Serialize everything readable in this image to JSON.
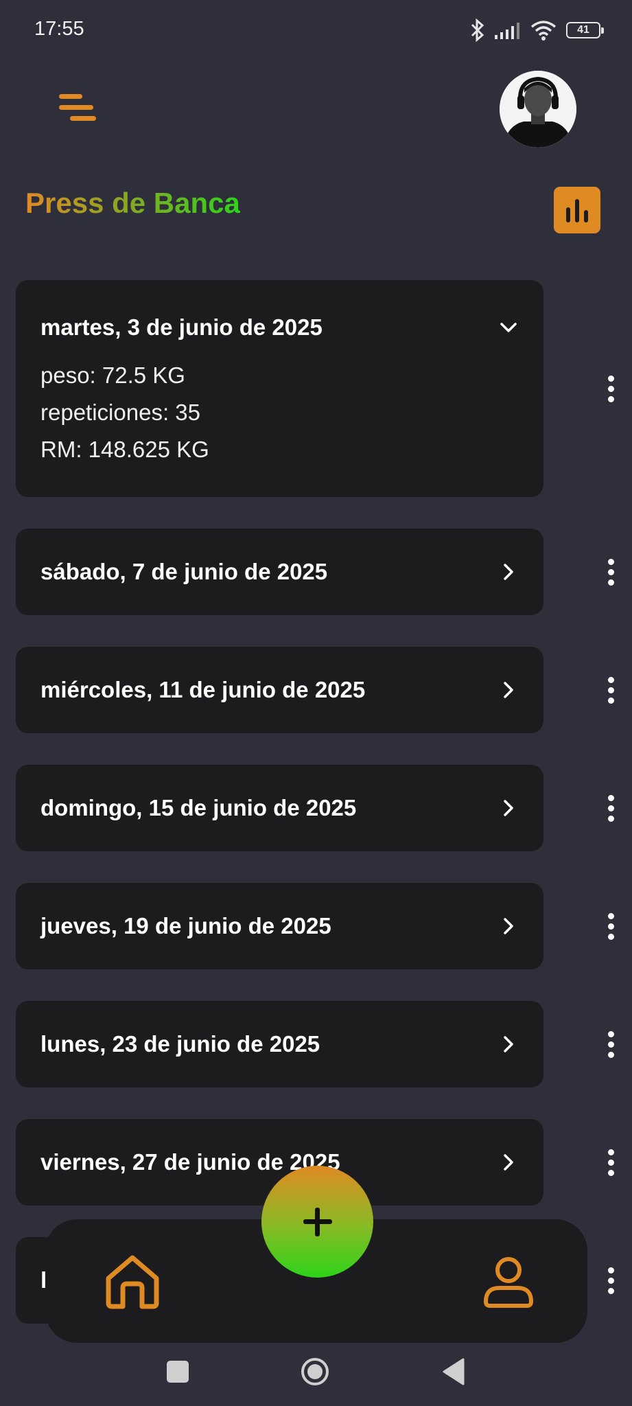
{
  "status_bar": {
    "time": "17:55",
    "battery": "41",
    "icons": [
      "bluetooth-icon",
      "signal-icon",
      "wifi-icon",
      "battery-icon"
    ]
  },
  "header": {
    "menu_icon": "menu-icon",
    "avatar": "profile-avatar",
    "title": "Press de Banca",
    "stats_icon": "bar-chart-icon"
  },
  "colors": {
    "accent_orange": "#e08a24",
    "accent_green": "#2ed31a",
    "background": "#2f2f3c",
    "card": "#1c1c1e"
  },
  "sessions": [
    {
      "date": "martes, 3 de junio de 2025",
      "expanded": true,
      "details": {
        "peso": "peso: 72.5 KG",
        "repeticiones": "repeticiones: 35",
        "rm": "RM: 148.625 KG"
      }
    },
    {
      "date": "sábado, 7 de junio de 2025",
      "expanded": false
    },
    {
      "date": "miércoles, 11 de junio de 2025",
      "expanded": false
    },
    {
      "date": "domingo, 15 de junio de 2025",
      "expanded": false
    },
    {
      "date": "jueves, 19 de junio de 2025",
      "expanded": false
    },
    {
      "date": "lunes, 23 de junio de 2025",
      "expanded": false
    },
    {
      "date": "viernes, 27 de junio de 2025",
      "expanded": false
    },
    {
      "date": "l",
      "expanded": false
    }
  ],
  "bottom_nav": {
    "home_icon": "home-icon",
    "add_icon": "plus-icon",
    "profile_icon": "person-icon"
  },
  "system_nav": [
    "recents-square-icon",
    "home-circle-icon",
    "back-triangle-icon"
  ]
}
